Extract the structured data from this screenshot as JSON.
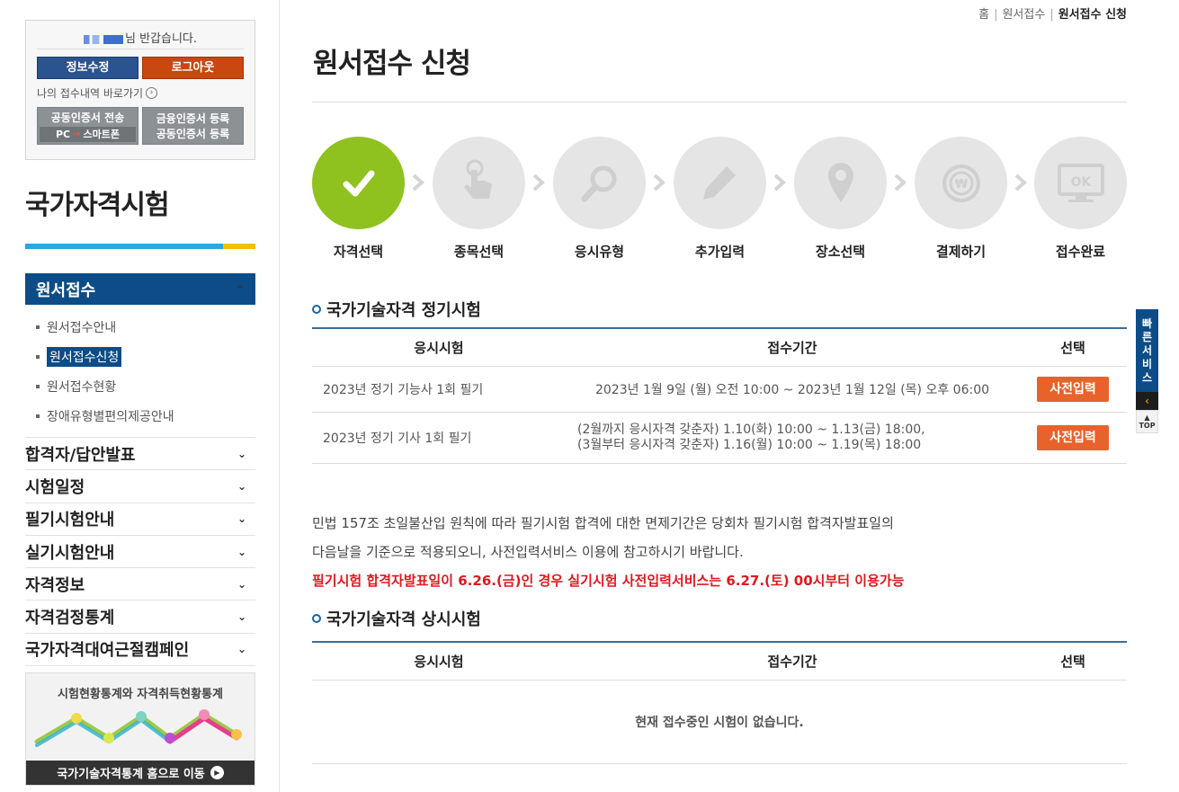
{
  "user": {
    "greeting_suffix": "님 반갑습니다."
  },
  "account": {
    "edit_label": "정보수정",
    "logout_label": "로그아웃",
    "history_link": "나의 접수내역 바로가기"
  },
  "certs": {
    "transfer_label": "공동인증서 전송",
    "transfer_from": "PC",
    "transfer_to": "스마트폰",
    "register_line1": "금융인증서 등록",
    "register_line2": "공동인증서 등록"
  },
  "sidebar": {
    "title": "국가자격시험",
    "active_menu": "원서접수",
    "submenu": [
      "원서접수안내",
      "원서접수신청",
      "원서접수현황",
      "장애유형별편의제공안내"
    ],
    "menu": [
      "합격자/답안발표",
      "시험일정",
      "필기시험안내",
      "실기시험안내",
      "자격정보",
      "자격검정통계",
      "국가자격대여근절캠페인"
    ],
    "banner_title": "시험현황통계와 자격취득현황통계",
    "banner_link": "국가기술자격통계 홈으로 이동"
  },
  "breadcrumb": {
    "home": "홈",
    "section": "원서접수",
    "current": "원서접수 신청"
  },
  "page_title": "원서접수 신청",
  "steps": [
    "자격선택",
    "종목선택",
    "응시유형",
    "추가입력",
    "장소선택",
    "결제하기",
    "접수완료"
  ],
  "regular": {
    "title": "국가기술자격 정기시험",
    "headers": [
      "응시시험",
      "접수기간",
      "선택"
    ],
    "rows": [
      {
        "exam": "2023년 정기 기능사 1회 필기",
        "period1": "2023년 1월 9일 (월) 오전 10:00 ~ 2023년 1월 12일 (목) 오후 06:00",
        "period2": "",
        "action": "사전입력"
      },
      {
        "exam": "2023년 정기 기사 1회 필기",
        "period1": "(2월까지 응시자격 갖춘자) 1.10(화) 10:00 ~ 1.13(금) 18:00,",
        "period2": "(3월부터 응시자격 갖춘자) 1.16(월) 10:00 ~ 1.19(목) 18:00",
        "action": "사전입력"
      }
    ]
  },
  "notice": {
    "line1": "민법 157조 초일불산입 원칙에 따라 필기시험 합격에 대한 면제기간은 당회차 필기시험 합격자발표일의",
    "line2": "다음날을 기준으로 적용되오니, 사전입력서비스 이용에 참고하시기 바랍니다.",
    "line3": "필기시험 합격자발표일이 6.26.(금)인 경우 실기시험 사전입력서비스는 6.27.(토) 00시부터 이용가능"
  },
  "standing": {
    "title": "국가기술자격 상시시험",
    "headers": [
      "응시시험",
      "접수기간",
      "선택"
    ],
    "empty": "현재 접수중인 시험이 없습니다."
  },
  "quick": {
    "label_chars": [
      "빠",
      "른",
      "서",
      "비",
      "스"
    ],
    "top": "TOP"
  }
}
